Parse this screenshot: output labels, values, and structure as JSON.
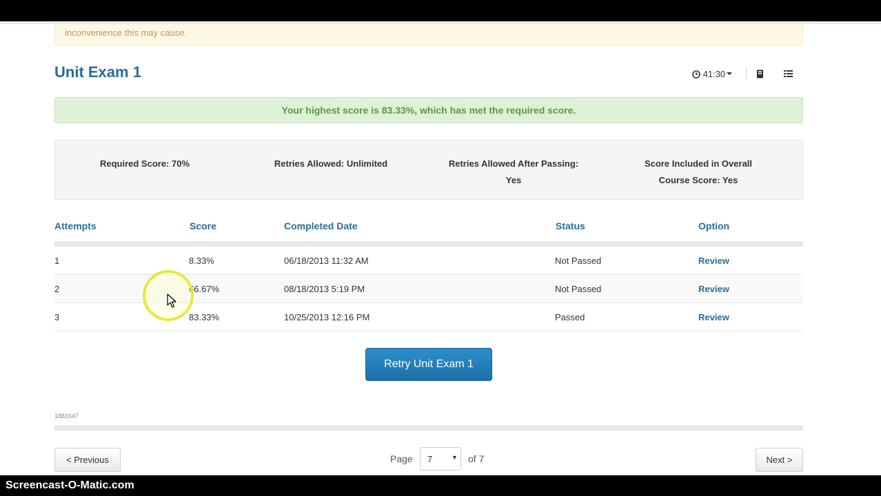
{
  "notice": {
    "text": "inconvenience this may cause."
  },
  "exam": {
    "title": "Unit Exam 1"
  },
  "toolbar": {
    "timer": "41:30"
  },
  "result": {
    "message": "Your highest score is 83.33%, which has met the required score."
  },
  "requirements": {
    "required_score": "Required Score: 70%",
    "retries_allowed": "Retries Allowed: Unlimited",
    "retries_after_passing_line1": "Retries Allowed After Passing:",
    "retries_after_passing_line2": "Yes",
    "included_line1": "Score Included in Overall",
    "included_line2": "Course Score: Yes"
  },
  "table": {
    "headers": [
      "Attempts",
      "Score",
      "Completed Date",
      "Status",
      "Option"
    ],
    "rows": [
      {
        "attempt": "1",
        "score": "8.33%",
        "date": "06/18/2013 11:32 AM",
        "status": "Not Passed",
        "option": "Review"
      },
      {
        "attempt": "2",
        "score": "66.67%",
        "date": "08/18/2013 5:19 PM",
        "status": "Not Passed",
        "option": "Review"
      },
      {
        "attempt": "3",
        "score": "83.33%",
        "date": "10/25/2013 12:16 PM",
        "status": "Passed",
        "option": "Review"
      }
    ]
  },
  "retry_button": "Retry Unit Exam 1",
  "footer_id": "1881647",
  "pagination": {
    "previous": "< Previous",
    "page_label": "Page",
    "current_page": "7",
    "of_label": "of 7",
    "next": "Next >"
  },
  "watermark": "Screencast-O-Matic.com",
  "colors": {
    "accent": "#2a6c9a",
    "success_bg": "#dff0d8",
    "success_text": "#5a9a3c",
    "warning_bg": "#fcf8e3",
    "button": "#1f7ab8"
  }
}
